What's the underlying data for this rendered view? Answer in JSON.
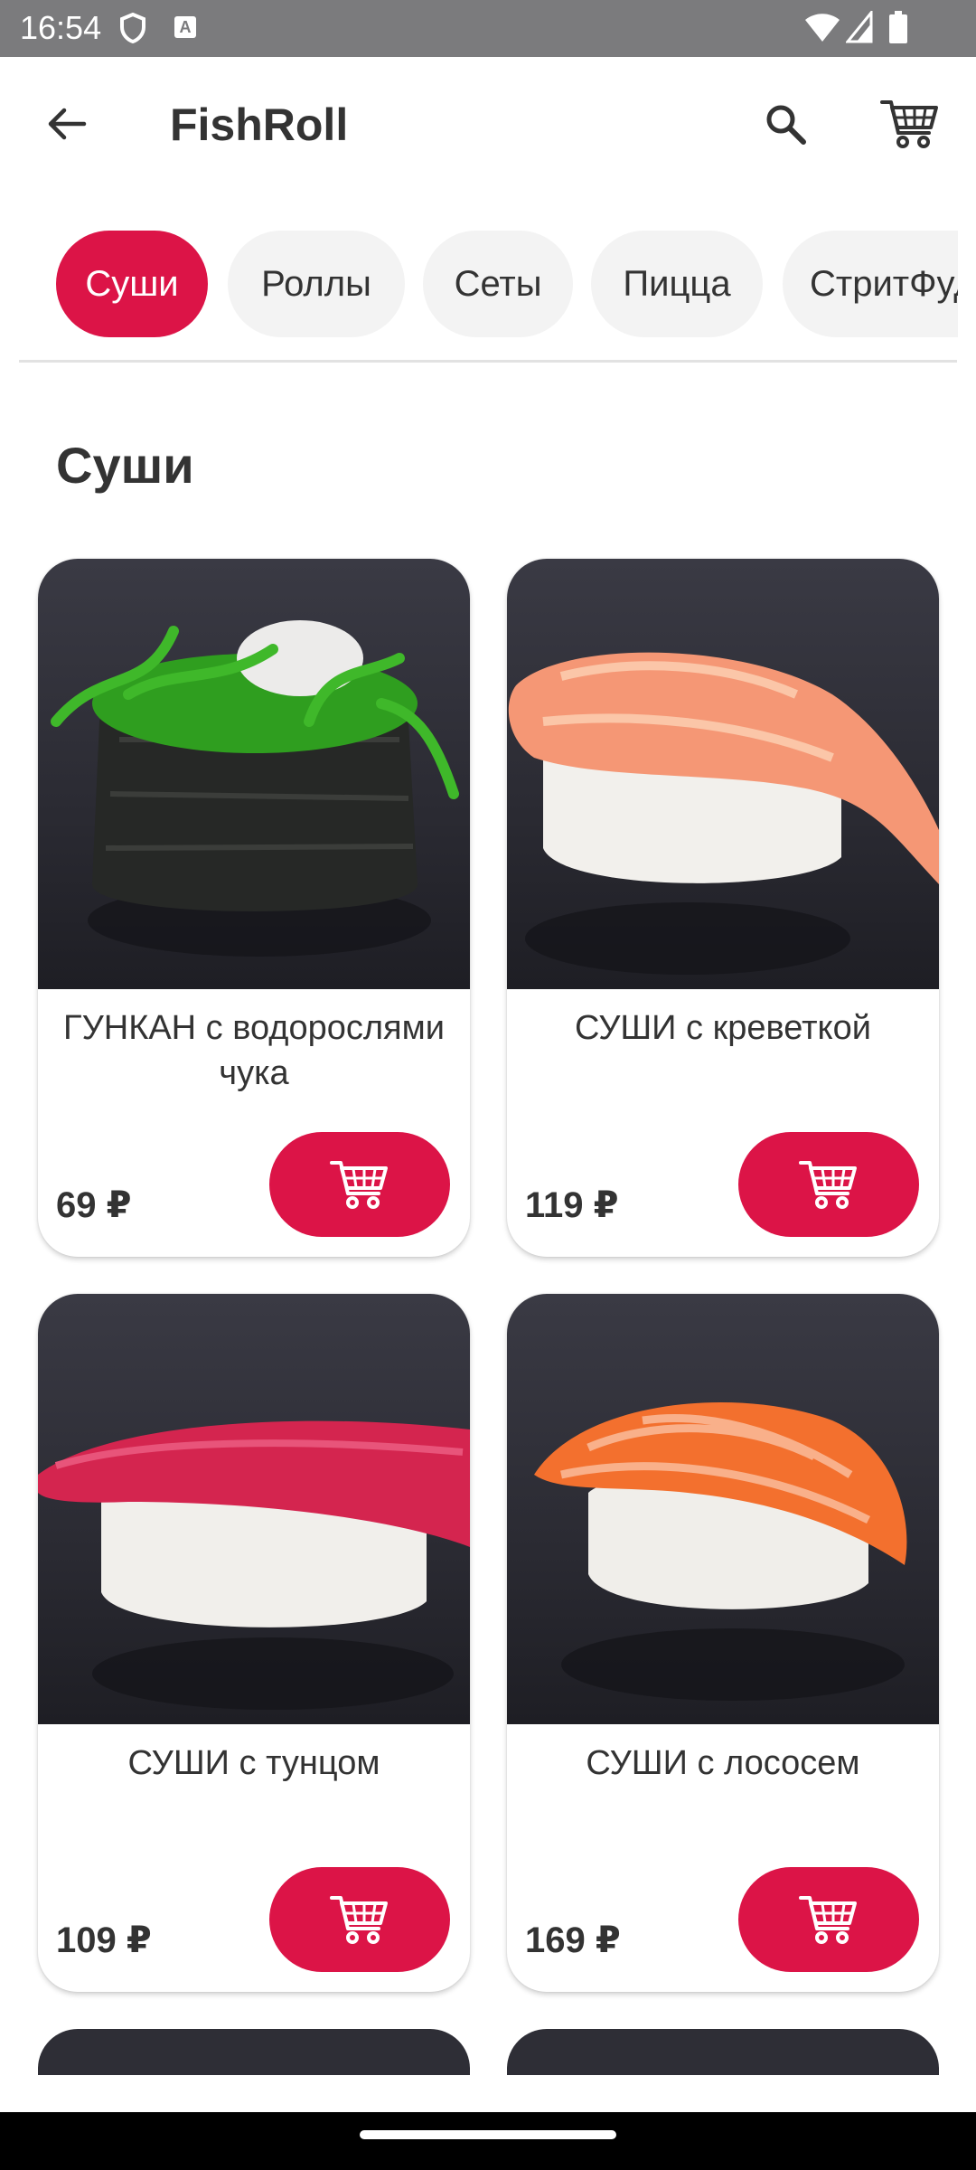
{
  "status_bar": {
    "time": "16:54",
    "a_icon": "A"
  },
  "appbar": {
    "title": "FishRoll",
    "icons": [
      "back-arrow-icon",
      "search-icon",
      "cart-icon"
    ]
  },
  "tabs": [
    {
      "label": "Суши",
      "active": true
    },
    {
      "label": "Роллы",
      "active": false
    },
    {
      "label": "Сеты",
      "active": false
    },
    {
      "label": "Пицца",
      "active": false
    },
    {
      "label": "СтритФуд",
      "active": false
    }
  ],
  "section_title": "Суши",
  "products": [
    {
      "name": "ГУНКАН с водорослями чука",
      "price": "69 ₽"
    },
    {
      "name": "СУШИ с креветкой",
      "price": "119 ₽"
    },
    {
      "name": "СУШИ с тунцом",
      "price": "109 ₽"
    },
    {
      "name": "СУШИ с лососем",
      "price": "169 ₽"
    }
  ],
  "colors": {
    "accent": "#dc1447",
    "status_bar": "#7b7b7d",
    "tab_inactive": "#f3f3f3",
    "image_bg": "#2e2e36"
  }
}
